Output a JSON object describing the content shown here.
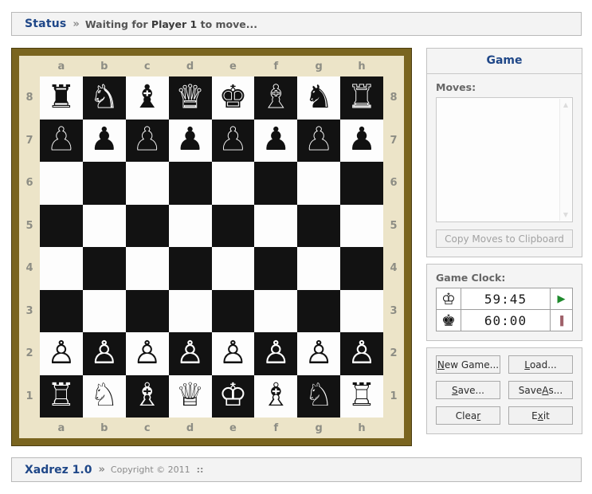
{
  "status": {
    "label": "Status",
    "separator": "»",
    "message_prefix": "Waiting for ",
    "message_highlight": "Player 1",
    "message_suffix": " to move..."
  },
  "board": {
    "files": [
      "a",
      "b",
      "c",
      "d",
      "e",
      "f",
      "g",
      "h"
    ],
    "ranks": [
      "8",
      "7",
      "6",
      "5",
      "4",
      "3",
      "2",
      "1"
    ],
    "frame_color": "#7a6520",
    "inner_color": "#ece4c8",
    "light_square_color": "#fdfdfd",
    "dark_square_color": "#121212",
    "a8_is_light": true,
    "position": [
      [
        "r",
        "n",
        "b",
        "q",
        "k",
        "b",
        "n",
        "r"
      ],
      [
        "p",
        "p",
        "p",
        "p",
        "p",
        "p",
        "p",
        "p"
      ],
      [
        "",
        "",
        "",
        "",
        "",
        "",
        "",
        ""
      ],
      [
        "",
        "",
        "",
        "",
        "",
        "",
        "",
        ""
      ],
      [
        "",
        "",
        "",
        "",
        "",
        "",
        "",
        ""
      ],
      [
        "",
        "",
        "",
        "",
        "",
        "",
        "",
        ""
      ],
      [
        "P",
        "P",
        "P",
        "P",
        "P",
        "P",
        "P",
        "P"
      ],
      [
        "R",
        "N",
        "B",
        "Q",
        "K",
        "B",
        "N",
        "R"
      ]
    ],
    "glyphs": {
      "K": "♔",
      "Q": "♕",
      "R": "♖",
      "B": "♗",
      "N": "♘",
      "P": "♙",
      "k": "♚",
      "q": "♛",
      "r": "♜",
      "b": "♝",
      "n": "♞",
      "p": "♟"
    }
  },
  "panel": {
    "title": "Game",
    "moves_label": "Moves:",
    "moves_value": "",
    "moves_placeholder": "",
    "copy_button": "Copy Moves to Clipboard",
    "copy_button_disabled": true,
    "clock_label": "Game Clock:",
    "clock": {
      "white": {
        "icon": "white-king-icon",
        "glyph": "♔",
        "time": "59:45",
        "control": "play",
        "control_glyph": "▶",
        "control_color": "#1f8a2d"
      },
      "black": {
        "icon": "black-king-icon",
        "glyph": "♚",
        "time": "60:00",
        "control": "pause",
        "control_glyph": "‖",
        "control_color": "#7a2430"
      }
    },
    "buttons": [
      {
        "name": "new-game-button",
        "pre": "",
        "key": "N",
        "post": "ew Game..."
      },
      {
        "name": "load-button",
        "pre": "",
        "key": "L",
        "post": "oad..."
      },
      {
        "name": "save-button",
        "pre": "",
        "key": "S",
        "post": "ave..."
      },
      {
        "name": "save-as-button",
        "pre": "Save ",
        "key": "A",
        "post": "s..."
      },
      {
        "name": "clear-button",
        "pre": "Clea",
        "key": "r",
        "post": ""
      },
      {
        "name": "exit-button",
        "pre": "E",
        "key": "x",
        "post": "it"
      }
    ]
  },
  "footer": {
    "brand": "Xadrez 1.0",
    "separator": "»",
    "copyright": "Copyright © 2011",
    "dots": "::"
  }
}
